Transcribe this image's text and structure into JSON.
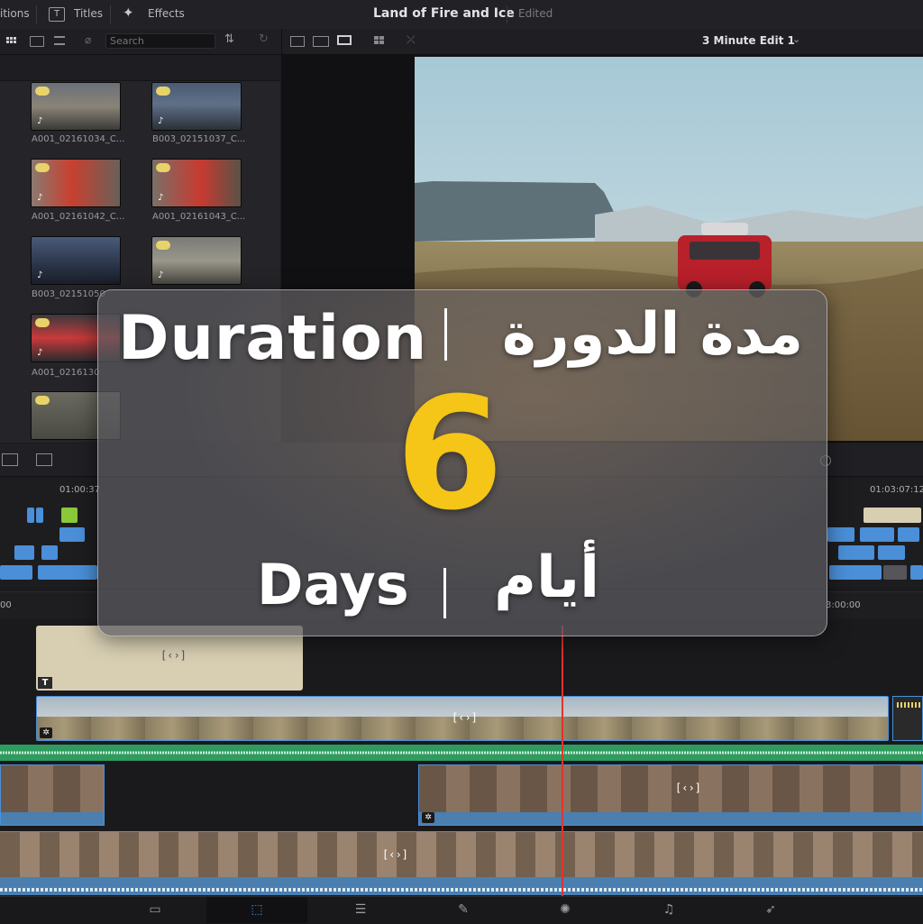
{
  "topbar": {
    "tab_editions": "itions",
    "tab_titles": "Titles",
    "tab_effects": "Effects",
    "project_title": "Land of Fire and Ice",
    "status": "Edited"
  },
  "toolbar": {
    "search_placeholder": "Search",
    "timeline_name": "3 Minute Edit 1"
  },
  "media_pool": {
    "clips": [
      {
        "label": "A001_02161034_C..."
      },
      {
        "label": "B003_02151037_C..."
      },
      {
        "label": "A001_02161042_C..."
      },
      {
        "label": "A001_02161043_C..."
      },
      {
        "label": "B003_02151050"
      },
      {
        "label": ""
      },
      {
        "label": "A001_0216130"
      },
      {
        "label": ""
      }
    ]
  },
  "timeline": {
    "tc_left": "01:00:37",
    "tc_right": "01:03:07:12",
    "ruler_left": "00",
    "ruler_right": "3:00:00"
  },
  "overlay": {
    "title_en": "Duration",
    "title_ar": "مدة الدورة",
    "number": "6",
    "unit_en": "Days",
    "unit_ar": "أيام"
  },
  "colors": {
    "accent_number": "#f5c518",
    "playhead": "#e0342f",
    "video_track": "#4a7fb0",
    "audio_track": "#2f9b5f",
    "title_clip": "#d8cfb3"
  },
  "icons": [
    "titles-icon",
    "effects-icon",
    "grid-view-icon",
    "search-icon",
    "cloud-icon",
    "music-note-icon",
    "fit-icon",
    "edit-page-icon",
    "fairlight-icon",
    "deliver-icon"
  ]
}
